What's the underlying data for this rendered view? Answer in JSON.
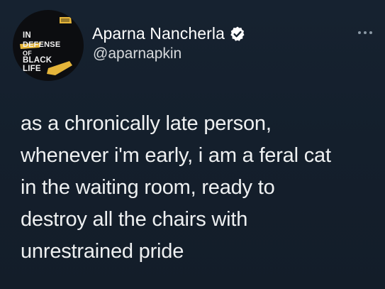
{
  "avatar": {
    "line1": "IN",
    "line2": "DEFENSE",
    "line3": "OF",
    "line4": "BLACK",
    "line5": "LIFE",
    "colors": {
      "background": "#0c0d10",
      "accent": "#e5b53a",
      "text": "#f2f2f2"
    }
  },
  "author": {
    "display_name": "Aparna Nancherla",
    "handle": "@aparnapkin",
    "verified_icon": "verified-badge-icon"
  },
  "menu": {
    "icon": "more-options-icon"
  },
  "tweet": {
    "lines": [
      "as a chronically late person,",
      "whenever i'm early, i am a feral cat",
      "in the waiting room, ready to",
      "destroy all the chairs with",
      "unrestrained pride"
    ]
  },
  "colors": {
    "background": "#14202e",
    "text": "#eef0f1",
    "muted": "#8b98a5"
  }
}
